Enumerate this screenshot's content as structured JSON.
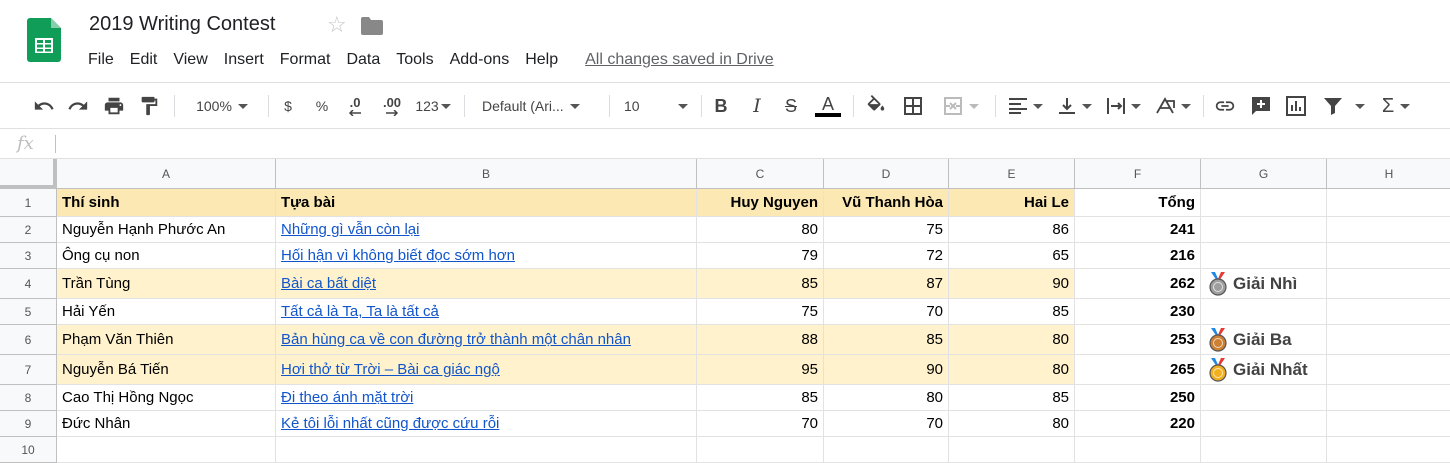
{
  "document": {
    "title": "2019 Writing Contest",
    "save_status": "All changes saved in Drive"
  },
  "menu": [
    "File",
    "Edit",
    "View",
    "Insert",
    "Format",
    "Data",
    "Tools",
    "Add-ons",
    "Help"
  ],
  "toolbar": {
    "zoom": "100%",
    "currency": "$",
    "percent": "%",
    "decrease_decimals": ".0",
    "increase_decimals": ".00",
    "more_formats": "123",
    "font": "Default (Ari...",
    "font_size": "10",
    "text_color": "#000000"
  },
  "formula_bar": {
    "label": "fx",
    "value": ""
  },
  "columns": [
    "A",
    "B",
    "C",
    "D",
    "E",
    "F",
    "G",
    "H"
  ],
  "rows": [
    "1",
    "2",
    "3",
    "4",
    "5",
    "6",
    "7",
    "8",
    "9",
    "10"
  ],
  "table": {
    "headers": [
      "Thí sinh",
      "Tựa bài",
      "Huy Nguyen",
      "Vũ Thanh Hòa",
      "Hai Le",
      "Tổng"
    ],
    "entries": [
      {
        "name": "Nguyễn Hạnh Phước An",
        "title": "Những gì vẫn còn lại",
        "scores": [
          "80",
          "75",
          "86"
        ],
        "total": "241",
        "highlight": false
      },
      {
        "name": "Ông cụ non",
        "title": "Hối hận vì không biết đọc sớm hơn",
        "scores": [
          "79",
          "72",
          "65"
        ],
        "total": "216",
        "highlight": false
      },
      {
        "name": "Trần Tùng",
        "title": "Bài ca bất diệt",
        "scores": [
          "85",
          "87",
          "90"
        ],
        "total": "262",
        "highlight": true
      },
      {
        "name": "Hải Yến",
        "title": "Tất cả là Ta, Ta là tất cả",
        "scores": [
          "75",
          "70",
          "85"
        ],
        "total": "230",
        "highlight": false
      },
      {
        "name": "Phạm Văn Thiên",
        "title": "Bản hùng ca về con đường trở thành một chân nhân",
        "scores": [
          "88",
          "85",
          "80"
        ],
        "total": "253",
        "highlight": true
      },
      {
        "name": "Nguyễn Bá Tiến",
        "title": "Hơi thở từ Trời – Bài ca giác ngộ",
        "scores": [
          "95",
          "90",
          "80"
        ],
        "total": "265",
        "highlight": true
      },
      {
        "name": "Cao Thị Hồng Ngọc",
        "title": "Đi theo ánh mặt trời",
        "scores": [
          "85",
          "80",
          "85"
        ],
        "total": "250",
        "highlight": false
      },
      {
        "name": "Đức Nhân",
        "title": "Kẻ tôi lỗi nhất cũng được cứu rỗi",
        "scores": [
          "70",
          "70",
          "80"
        ],
        "total": "220",
        "highlight": false
      }
    ]
  },
  "awards": [
    {
      "row": 4,
      "label": "Giải Nhì",
      "medal": "silver-medal-icon",
      "color": "#9e9e9e"
    },
    {
      "row": 6,
      "label": "Giải Ba",
      "medal": "bronze-medal-icon",
      "color": "#cd7f32"
    },
    {
      "row": 7,
      "label": "Giải Nhất",
      "medal": "gold-medal-icon",
      "color": "#f2b01e"
    }
  ],
  "colors": {
    "header_fill": "#fce8b2",
    "highlight_fill": "#fff2cc",
    "link": "#1155cc",
    "sheets_green": "#0f9d58"
  }
}
